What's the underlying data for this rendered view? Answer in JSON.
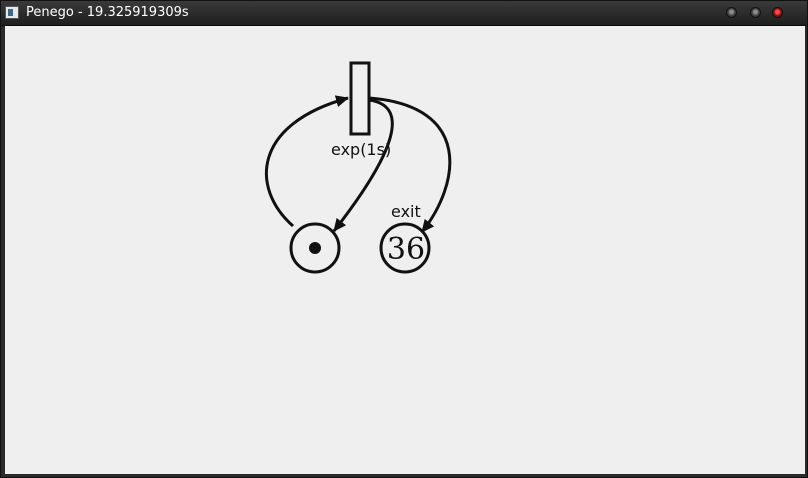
{
  "window": {
    "title": "Penego - 19.325919309s",
    "controls": [
      "minimize",
      "maximize",
      "close"
    ]
  },
  "colors": {
    "canvas_background": "#efefef",
    "stroke": "#111111",
    "close_button": "#e03030"
  },
  "petri_net": {
    "transition": {
      "label": "exp(1s)"
    },
    "places": [
      {
        "id": "loop-place",
        "tokens": 1,
        "label": ""
      },
      {
        "id": "exit-place",
        "tokens": "36",
        "label": "exit"
      }
    ],
    "arcs": [
      {
        "from": "loop-place",
        "to": "transition"
      },
      {
        "from": "transition",
        "to": "loop-place"
      },
      {
        "from": "transition",
        "to": "exit-place"
      }
    ]
  }
}
